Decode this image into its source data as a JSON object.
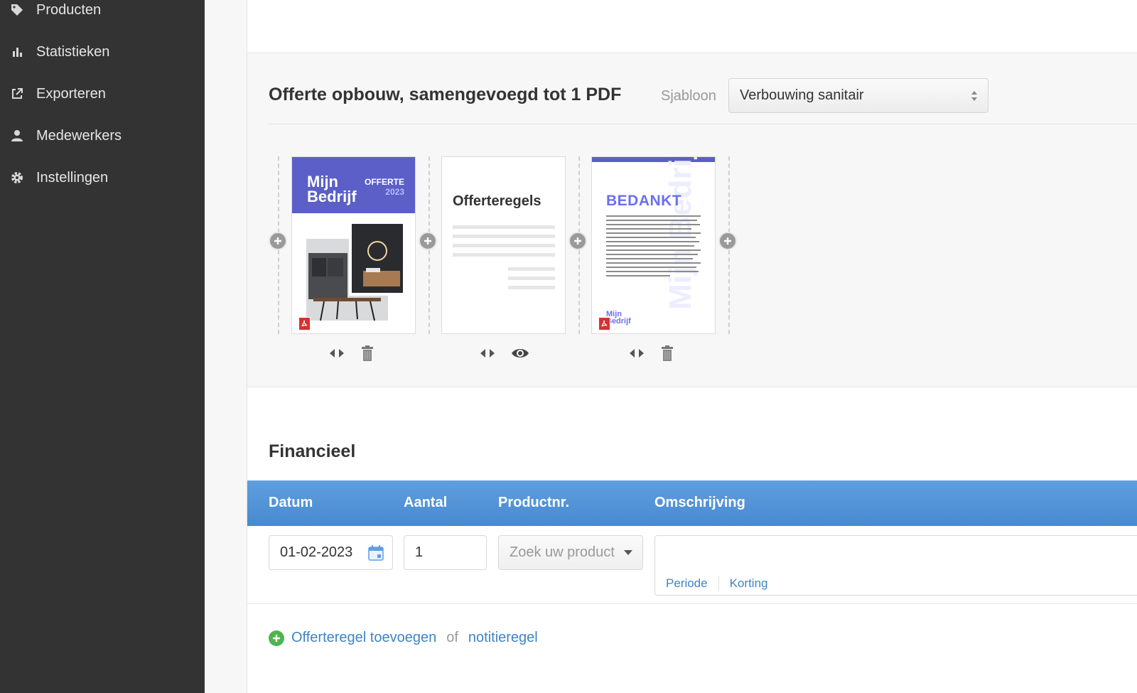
{
  "sidebar": {
    "items": [
      {
        "label": "Producten",
        "icon": "tag-icon"
      },
      {
        "label": "Statistieken",
        "icon": "bar-chart-icon"
      },
      {
        "label": "Exporteren",
        "icon": "export-icon"
      },
      {
        "label": "Medewerkers",
        "icon": "user-icon"
      },
      {
        "label": "Instellingen",
        "icon": "gear-icon"
      }
    ]
  },
  "builder": {
    "title": "Offerte opbouw, samengevoegd tot 1 PDF",
    "template_label": "Sjabloon",
    "template_value": "Verbouwing sanitair",
    "pages": {
      "cover": {
        "brand_line1": "Mijn",
        "brand_line2": "Bedrijf",
        "offer": "OFFERTE",
        "year": "2023"
      },
      "lines": {
        "title": "Offerteregels"
      },
      "thanks": {
        "title": "BEDANKT",
        "watermark": "Mijn Bedrijf",
        "logo_line1": "Mijn",
        "logo_line2": "Bedrijf"
      }
    }
  },
  "financial": {
    "title": "Financieel",
    "columns": [
      "Datum",
      "Aantal",
      "Productnr.",
      "Omschrijving"
    ],
    "row": {
      "date": "01-02-2023",
      "quantity": "1",
      "product_placeholder": "Zoek uw product",
      "links": [
        "Periode",
        "Korting"
      ]
    },
    "add_line": "Offerteregel toevoegen",
    "or": "of",
    "note_line": "notitieregel"
  },
  "colors": {
    "sidebar": "#333333",
    "accent": "#5b5fc7",
    "table_header": "#4a8bd0",
    "link": "#3f84c5",
    "add": "#4fb44f"
  }
}
